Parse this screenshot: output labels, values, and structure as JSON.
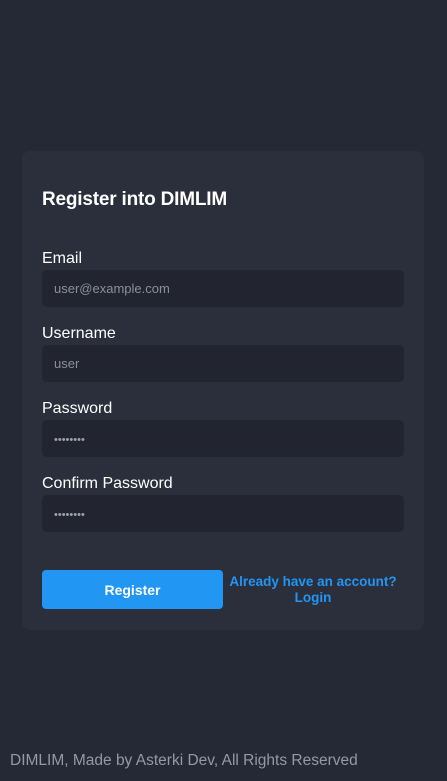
{
  "form": {
    "title": "Register into DIMLIM",
    "email": {
      "label": "Email",
      "placeholder": "user@example.com"
    },
    "username": {
      "label": "Username",
      "placeholder": "user"
    },
    "password": {
      "label": "Password",
      "placeholder": "••••••••"
    },
    "confirm_password": {
      "label": "Confirm Password",
      "placeholder": "••••••••"
    },
    "register_label": "Register",
    "login_link_line1": "Already have an account?",
    "login_link_line2": "Login"
  },
  "footer": {
    "text": "DIMLIM, Made by Asterki Dev, All Rights Reserved"
  },
  "colors": {
    "background": "#252935",
    "card": "#2b2f3b",
    "input": "#22252f",
    "accent": "#2196f3"
  }
}
